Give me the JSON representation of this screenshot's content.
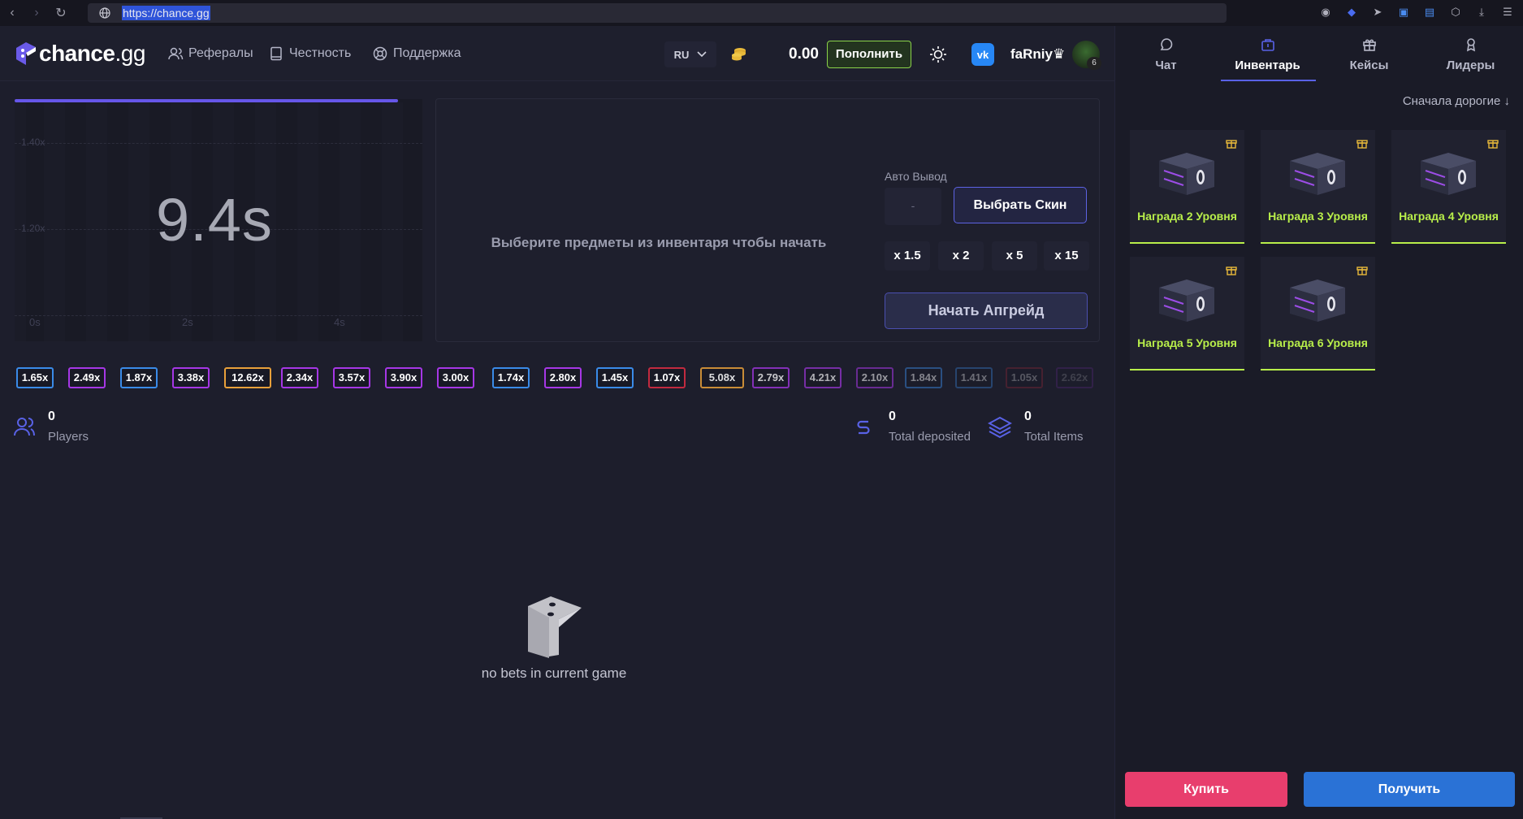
{
  "browser": {
    "url": "https://chance.gg"
  },
  "header": {
    "logo_name": "chance",
    "logo_suffix": ".gg",
    "nav": [
      {
        "label": "Рефералы",
        "icon": "users-icon"
      },
      {
        "label": "Честность",
        "icon": "book-icon"
      },
      {
        "label": "Поддержка",
        "icon": "lifebuoy-icon"
      }
    ],
    "language": "RU",
    "balance": "0.00",
    "deposit_label": "Пополнить",
    "username": "faRniy♛",
    "level": "6"
  },
  "graph": {
    "timer": "9.4s",
    "progress": 0.94,
    "y_labels": [
      "1.40x",
      "1.20x"
    ],
    "x_labels": [
      "0s",
      "2s",
      "4s"
    ]
  },
  "upgrade": {
    "hint": "Выберите предметы из инвентаря чтобы начать",
    "auto_label": "Авто Вывод",
    "auto_value": "-",
    "skin_label": "Выбрать Скин",
    "multipliers": [
      "x 1.5",
      "x 2",
      "x 5",
      "x 15"
    ],
    "start_label": "Начать Апгрейд"
  },
  "history": [
    {
      "value": "1.65x",
      "color": "#3a8be8"
    },
    {
      "value": "2.49x",
      "color": "#a637e6"
    },
    {
      "value": "1.87x",
      "color": "#3a8be8"
    },
    {
      "value": "3.38x",
      "color": "#a637e6"
    },
    {
      "value": "12.62x",
      "color": "#e8a03a"
    },
    {
      "value": "2.34x",
      "color": "#a637e6"
    },
    {
      "value": "3.57x",
      "color": "#a637e6"
    },
    {
      "value": "3.90x",
      "color": "#a637e6"
    },
    {
      "value": "3.00x",
      "color": "#a637e6"
    },
    {
      "value": "1.74x",
      "color": "#3a8be8"
    },
    {
      "value": "2.80x",
      "color": "#a637e6"
    },
    {
      "value": "1.45x",
      "color": "#3a8be8"
    },
    {
      "value": "1.07x",
      "color": "#c22a3f"
    },
    {
      "value": "5.08x",
      "color": "#e8a03a"
    },
    {
      "value": "2.79x",
      "color": "#a637e6"
    },
    {
      "value": "4.21x",
      "color": "#a637e6"
    },
    {
      "value": "2.10x",
      "color": "#a637e6"
    },
    {
      "value": "1.84x",
      "color": "#3a8be8"
    },
    {
      "value": "1.41x",
      "color": "#3a8be8"
    },
    {
      "value": "1.05x",
      "color": "#c22a3f"
    },
    {
      "value": "2.62x",
      "color": "#a637e6"
    }
  ],
  "stats": {
    "players_count": "0",
    "players_label": "Players",
    "deposited_count": "0",
    "deposited_label": "Total deposited",
    "items_count": "0",
    "items_label": "Total Items"
  },
  "empty_text": "no bets in current game",
  "sidebar": {
    "tabs": [
      {
        "label": "Чат",
        "icon": "chat-icon"
      },
      {
        "label": "Инвентарь",
        "icon": "inventory-icon",
        "active": true
      },
      {
        "label": "Кейсы",
        "icon": "gift-icon"
      },
      {
        "label": "Лидеры",
        "icon": "trophy-icon"
      }
    ],
    "sort_label": "Сначала дорогие ↓",
    "items": [
      {
        "label": "Награда 2 Уровня"
      },
      {
        "label": "Награда 3 Уровня"
      },
      {
        "label": "Награда 4 Уровня"
      },
      {
        "label": "Награда 5 Уровня"
      },
      {
        "label": "Награда 6 Уровня"
      }
    ],
    "buy_label": "Купить",
    "get_label": "Получить"
  },
  "colors": {
    "accent": "#5962e6",
    "reward": "#b8ee4a",
    "buy": "#e83e6d",
    "get": "#2a72d6"
  }
}
